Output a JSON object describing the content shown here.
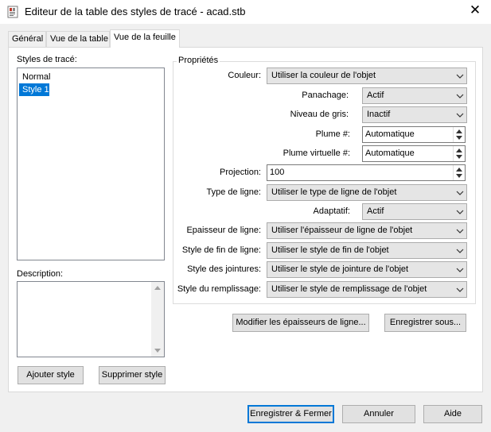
{
  "window": {
    "title": "Editeur de la table des styles de tracé - acad.stb",
    "close_glyph": "✕"
  },
  "tabs": [
    {
      "label": "Général"
    },
    {
      "label": "Vue de la table"
    },
    {
      "label": "Vue de la feuille"
    }
  ],
  "styles_panel": {
    "label": "Styles de tracé:",
    "items": [
      "Normal",
      "Style 1"
    ],
    "selected": "Style 1"
  },
  "description": {
    "label": "Description:",
    "value": ""
  },
  "left_buttons": {
    "add": "Ajouter style",
    "delete": "Supprimer style"
  },
  "properties": {
    "group_label": "Propriétés",
    "color": {
      "label": "Couleur:",
      "value": "Utiliser la couleur de l'objet"
    },
    "dithering": {
      "label": "Panachage:",
      "value": "Actif"
    },
    "grayscale": {
      "label": "Niveau de gris:",
      "value": "Inactif"
    },
    "pen": {
      "label": "Plume #:",
      "value": "Automatique"
    },
    "virtual_pen": {
      "label": "Plume virtuelle #:",
      "value": "Automatique"
    },
    "screening": {
      "label": "Projection:",
      "value": "100"
    },
    "linetype": {
      "label": "Type de ligne:",
      "value": "Utiliser le type de ligne de l'objet"
    },
    "adaptive": {
      "label": "Adaptatif:",
      "value": "Actif"
    },
    "lineweight": {
      "label": "Epaisseur de ligne:",
      "value": "Utiliser l'épaisseur de ligne de l'objet"
    },
    "line_end": {
      "label": "Style de fin de ligne:",
      "value": "Utiliser le style de fin de l'objet"
    },
    "line_join": {
      "label": "Style des jointures:",
      "value": "Utiliser le style de jointure de l'objet"
    },
    "fill": {
      "label": "Style du remplissage:",
      "value": "Utiliser le style de remplissage de l'objet"
    }
  },
  "prop_buttons": {
    "edit_lineweights": "Modifier les épaisseurs de ligne...",
    "save_as": "Enregistrer sous..."
  },
  "footer": {
    "save_close": "Enregistrer & Fermer",
    "cancel": "Annuler",
    "help": "Aide"
  },
  "colors": {
    "selection": "#0078d7",
    "window_bg": "#f0f0f0",
    "panel_bg": "#ffffff"
  }
}
